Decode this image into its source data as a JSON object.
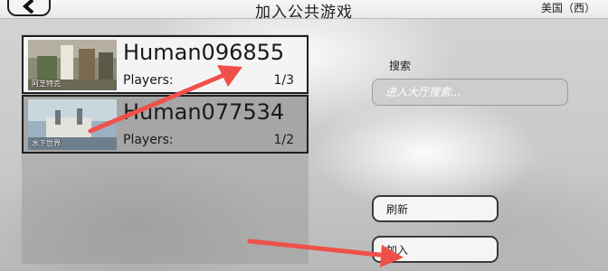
{
  "header": {
    "title": "加入公共游戏",
    "region": "美国（西）",
    "back_icon": "chevron-left-icon"
  },
  "games": [
    {
      "name": "Human096855",
      "players_label": "Players:",
      "players": "1/3",
      "map": "阿芝特克",
      "selected": true
    },
    {
      "name": "Human077534",
      "players_label": "Players:",
      "players": "1/2",
      "map": "水下世界",
      "selected": false
    }
  ],
  "search": {
    "label": "搜索",
    "placeholder": "进入大厅搜索..."
  },
  "buttons": {
    "refresh": "刷新",
    "join": "加入"
  },
  "colors": {
    "annotation_arrow": "#f0504a",
    "selected_row": "#f4f4f4",
    "unselected_row": "#a6a6a6"
  }
}
